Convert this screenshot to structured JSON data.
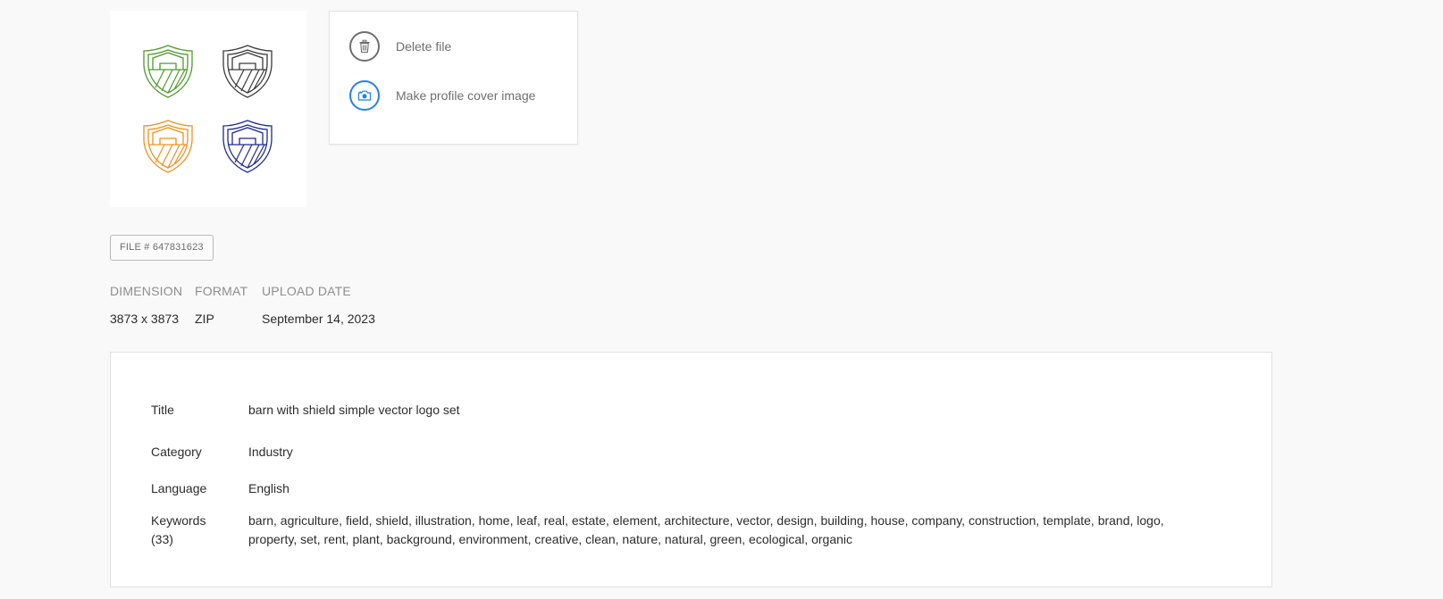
{
  "thumbnail": {
    "icon_colors": [
      "#4e9a2c",
      "#3a3a3a",
      "#f0901e",
      "#1f2a8a"
    ]
  },
  "actions": {
    "delete_label": "Delete file",
    "cover_label": "Make profile cover image"
  },
  "file_badge": "FILE # 647831623",
  "meta": {
    "dimension_head": "DIMENSION",
    "dimension_val": "3873 x 3873",
    "format_head": "FORMAT",
    "format_val": "ZIP",
    "upload_head": "UPLOAD DATE",
    "upload_val": "September 14, 2023"
  },
  "details": {
    "title_key": "Title",
    "title_val": "barn with shield simple vector logo set",
    "category_key": "Category",
    "category_val": "Industry",
    "language_key": "Language",
    "language_val": "English",
    "keywords_key": "Keywords",
    "keywords_count": "(33)",
    "keywords_val": "barn, agriculture, field, shield, illustration, home, leaf, real, estate, element, architecture, vector, design, building, house, company, construction, template, brand, logo, property, set, rent, plant, background, environment, creative, clean, nature, natural, green, ecological, organic"
  },
  "colors": {
    "accent_blue": "#2680eb",
    "icon_gray": "#6e6e6e"
  }
}
